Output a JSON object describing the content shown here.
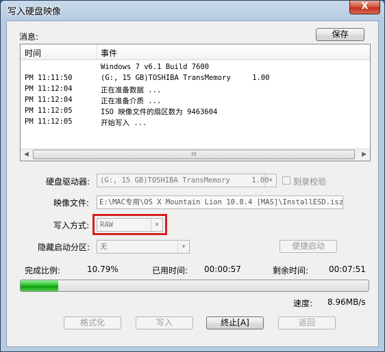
{
  "window": {
    "title": "写入硬盘映像",
    "close_label": "X"
  },
  "messages": {
    "label": "消息:",
    "save_label": "保存",
    "columns": [
      "时间",
      "事件"
    ],
    "rows": [
      {
        "time": "",
        "event": "Windows 7 v6.1 Build 7600"
      },
      {
        "time": "PM 11:11:50",
        "event": "(G:, 15 GB)TOSHIBA TransMemory     1.00"
      },
      {
        "time": "PM 11:12:04",
        "event": "正在准备数据 ..."
      },
      {
        "time": "PM 11:12:04",
        "event": "正在准备介质 ..."
      },
      {
        "time": "PM 11:12:05",
        "event": "ISO 映像文件的扇区数为 9463604"
      },
      {
        "time": "PM 11:12:05",
        "event": "开始写入 ..."
      }
    ],
    "scroll_grip": "III"
  },
  "form": {
    "drive_label": "硬盘驱动器:",
    "drive_value": "(G:, 15 GB)TOSHIBA TransMemory     1.00",
    "verify_label": "刻录校验",
    "image_label": "映像文件:",
    "image_value": "E:\\MAC专用\\OS X Mountain Lion 10.8.4 [MAS]\\InstallESD.isz",
    "method_label": "写入方式:",
    "method_value": "RAW",
    "hidden_label": "隐藏启动分区:",
    "hidden_value": "无",
    "quick_boot_label": "便捷启动"
  },
  "status": {
    "done_label": "完成比例:",
    "done_value": "10.79%",
    "progress_fraction": 0.1079,
    "elapsed_label": "已用时间:",
    "elapsed_value": "00:00:57",
    "remaining_label": "剩余时间:",
    "remaining_value": "00:07:51",
    "speed_label": "速度:",
    "speed_value": "8.96MB/s"
  },
  "buttons": {
    "format": "格式化",
    "write": "写入",
    "stop": "终止[A]",
    "back": "返回"
  },
  "colors": {
    "highlight": "#d81e1e",
    "progress": "#2ec42e"
  }
}
